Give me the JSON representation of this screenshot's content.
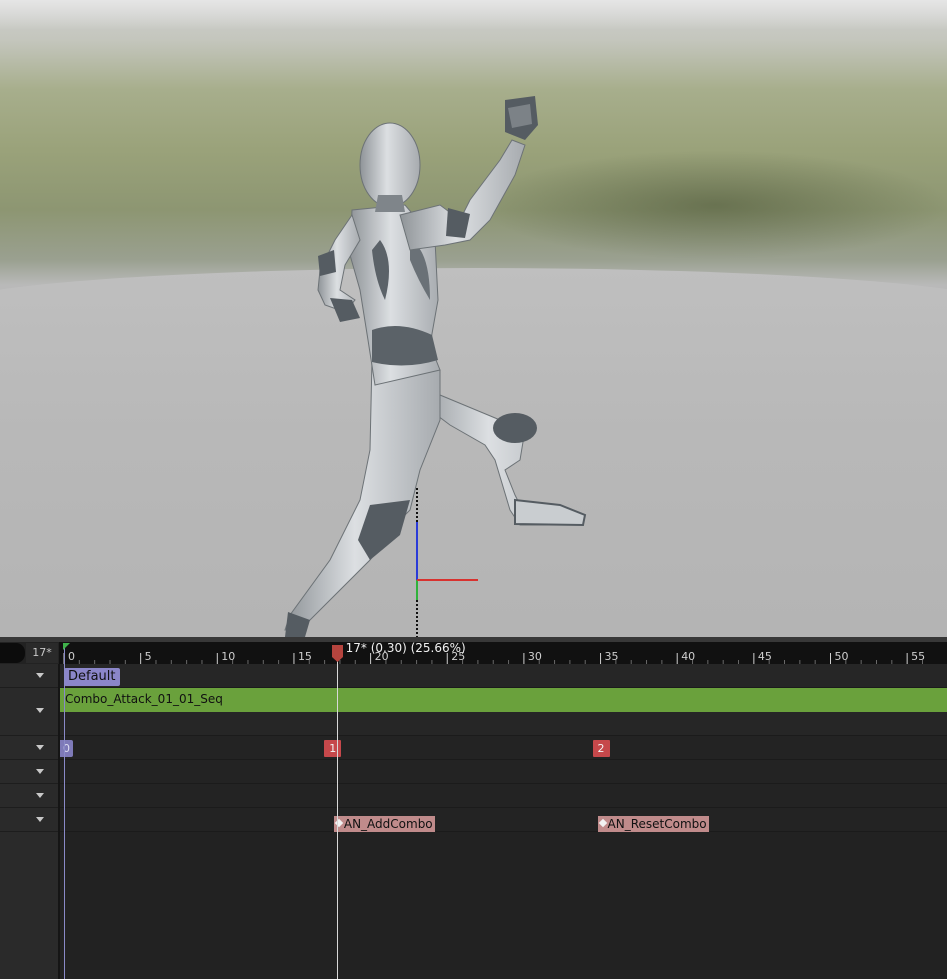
{
  "viewport": {
    "description_icon": "mannequin-figure"
  },
  "timeline": {
    "current_frame_label": "17*",
    "playhead_readout": "17* (0.30) (25.66%)",
    "playhead_frame": 17,
    "total_frames_visible": 57,
    "ruler_ticks": [
      "0",
      "5",
      "10",
      "15",
      "20",
      "25",
      "30",
      "35",
      "40",
      "45",
      "50",
      "55"
    ],
    "tracks": {
      "montage_section": "Default",
      "sequence": "Combo_Attack_01_01_Seq",
      "markers": [
        {
          "label": "0",
          "frame": 0
        },
        {
          "label": "1",
          "frame": 17.5
        },
        {
          "label": "2",
          "frame": 35
        }
      ],
      "notifies": [
        {
          "label": "AN_AddCombo",
          "frame": 17.8
        },
        {
          "label": "AN_ResetCombo",
          "frame": 35
        }
      ]
    },
    "colors": {
      "section": "#8b86c9",
      "sequence": "#6aa13c",
      "marker": "#c6484b",
      "notify": "#c08b8b",
      "playhead": "#b5443e"
    }
  }
}
